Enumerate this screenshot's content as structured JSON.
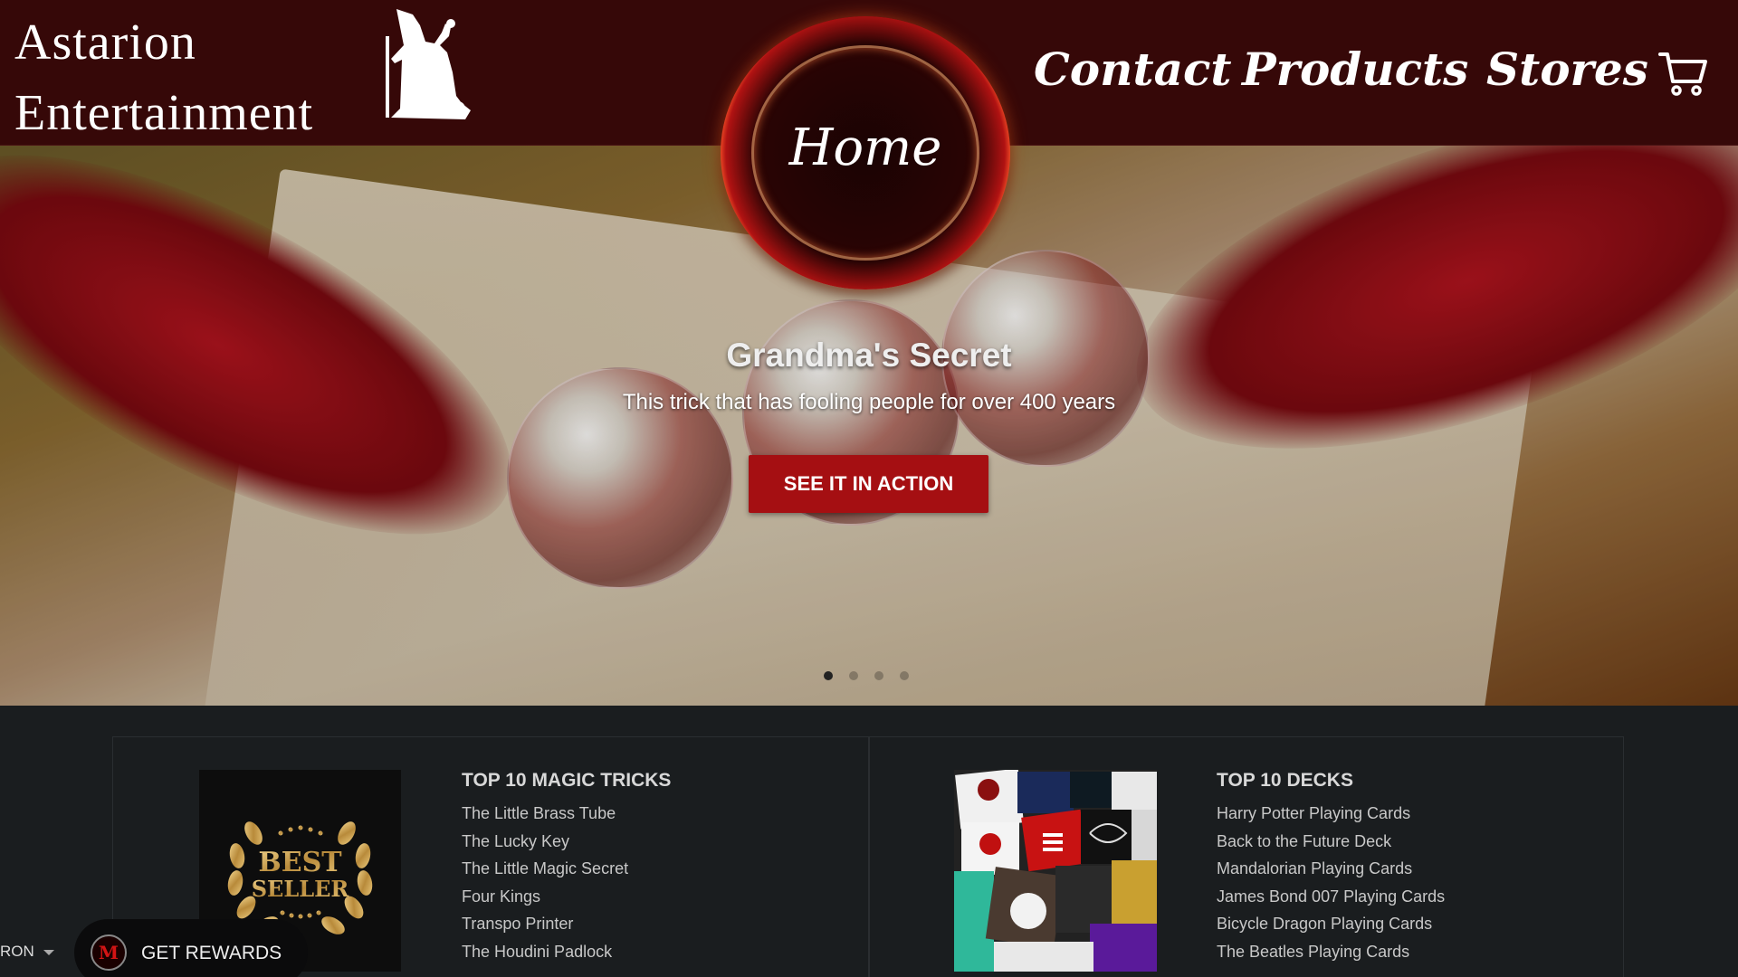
{
  "header": {
    "brand_line1": "Astarion",
    "brand_line2": "Entertainment",
    "home_label": "Home",
    "nav": {
      "contact": "Contact",
      "products": "Products",
      "stores": "Stores"
    }
  },
  "hero": {
    "title": "Grandma's Secret",
    "subtitle": "This trick that has fooling people for over 400 years",
    "cta_label": "SEE IT IN ACTION",
    "slide_count": 4,
    "active_slide": 1
  },
  "sections": {
    "tricks": {
      "title": "TOP 10 MAGIC TRICKS",
      "badge_line1": "BEST",
      "badge_line2": "SELLER",
      "items": [
        "The Little Brass Tube",
        "The Lucky Key",
        "The Little Magic Secret",
        "Four Kings",
        "Transpo Printer",
        "The Houdini Padlock"
      ]
    },
    "decks": {
      "title": "TOP 10 DECKS",
      "items": [
        "Harry Potter Playing Cards",
        "Back to the Future Deck",
        "Mandalorian Playing Cards",
        "James Bond 007 Playing Cards",
        "Bicycle Dragon Playing Cards",
        "The Beatles Playing Cards"
      ]
    }
  },
  "footer": {
    "language": "RON",
    "rewards_label": "GET REWARDS",
    "rewards_logo": "M"
  },
  "colors": {
    "header_bg": "#360808",
    "cta_bg": "#a50f12",
    "page_bg": "#1a1d1f"
  },
  "icons": [
    "wizard-logo-icon",
    "cart-icon",
    "rewards-logo-icon",
    "caret-down-icon"
  ]
}
